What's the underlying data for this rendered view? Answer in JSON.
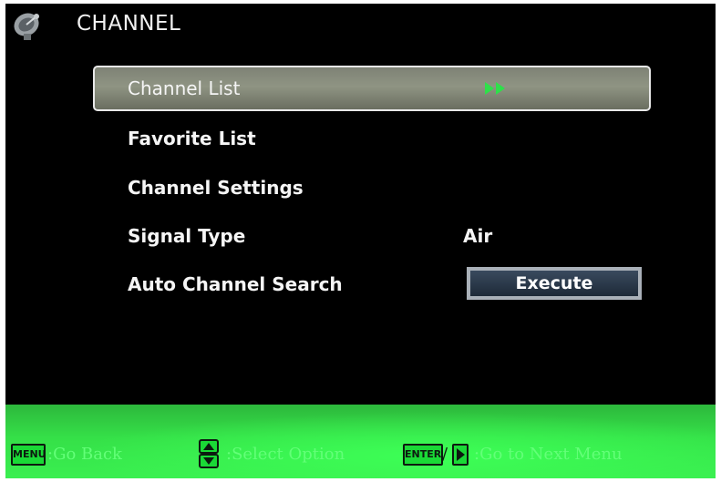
{
  "header": {
    "title": "CHANNEL",
    "icon": "satellite-dish-icon"
  },
  "menu": {
    "items": [
      {
        "label": "Channel List",
        "selected": true,
        "indicator": "double-arrow-right-icon"
      },
      {
        "label": "Favorite List"
      },
      {
        "label": "Channel Settings"
      },
      {
        "label": "Signal Type",
        "value": "Air"
      },
      {
        "label": "Auto Channel Search",
        "button": "Execute"
      }
    ]
  },
  "footer": {
    "menu_key": "MENU",
    "go_back": ":Go Back",
    "select_option": ":Select Option",
    "enter_key": "ENTER",
    "slash": "/",
    "next_menu": ":Go to Next Menu"
  },
  "colors": {
    "background": "#000000",
    "footer_green": "#35e048",
    "selected_highlight": "#8f9483",
    "arrow_green": "#2ee04a",
    "text": "#f5f5f5"
  }
}
